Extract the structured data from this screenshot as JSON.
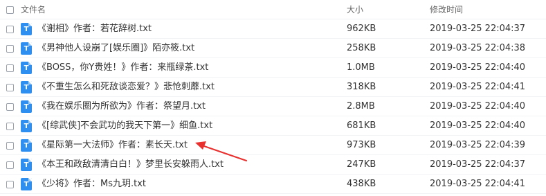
{
  "header": {
    "name_label": "文件名",
    "size_label": "大小",
    "time_label": "修改时间"
  },
  "files": [
    {
      "name": "《谢相》作者：若花辞树.txt",
      "size": "962KB",
      "modified": "2019-03-25 22:04:37"
    },
    {
      "name": "《男神他人设崩了[娱乐圈]》陌亦筱.txt",
      "size": "258KB",
      "modified": "2019-03-25 22:04:38"
    },
    {
      "name": "《BOSS，你Y贵姓！》作者：来瓶绿茶.txt",
      "size": "1.0MB",
      "modified": "2019-03-25 22:04:40"
    },
    {
      "name": "《不重生怎么和死敌谈恋爱？》悲怆刺蘼.txt",
      "size": "318KB",
      "modified": "2019-03-25 22:04:41"
    },
    {
      "name": "《我在娱乐圈为所欲为》作者：祭望月.txt",
      "size": "2.8MB",
      "modified": "2019-03-25 22:04:40"
    },
    {
      "name": "《[综武侠]不会武功的我天下第一》细鱼.txt",
      "size": "681KB",
      "modified": "2019-03-25 22:04:40"
    },
    {
      "name": "《星际第一大法师》作者：素长天.txt",
      "size": "973KB",
      "modified": "2019-03-25 22:04:39"
    },
    {
      "name": "《本王和政敌清清白白！》梦里长安躲雨人.txt",
      "size": "247KB",
      "modified": "2019-03-25 22:04:37"
    },
    {
      "name": "《少将》作者：Ms九玥.txt",
      "size": "438KB",
      "modified": "2019-03-25 22:04:41"
    }
  ],
  "icons": {
    "file_icon": "txt-file-icon",
    "file_icon_glyph": "T",
    "file_icon_color": "#2f8ff0",
    "annotation": "red-arrow-icon",
    "annotation_color": "#e8312f"
  }
}
